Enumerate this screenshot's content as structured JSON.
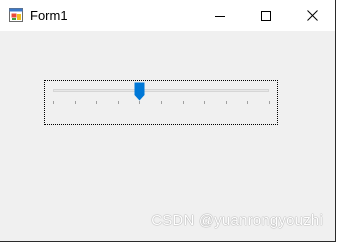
{
  "window": {
    "title": "Form1",
    "app_icon": "winforms-app-icon",
    "controls": {
      "minimize_icon": "minimize-icon",
      "maximize_icon": "maximize-icon",
      "close_icon": "close-icon"
    }
  },
  "trackbar": {
    "minimum": 0,
    "maximum": 10,
    "value": 4,
    "tick_count": 11,
    "thumb_color": "#0078d7",
    "focused": true
  },
  "watermark": {
    "text": "CSDN @yuanrongyouzhi"
  }
}
